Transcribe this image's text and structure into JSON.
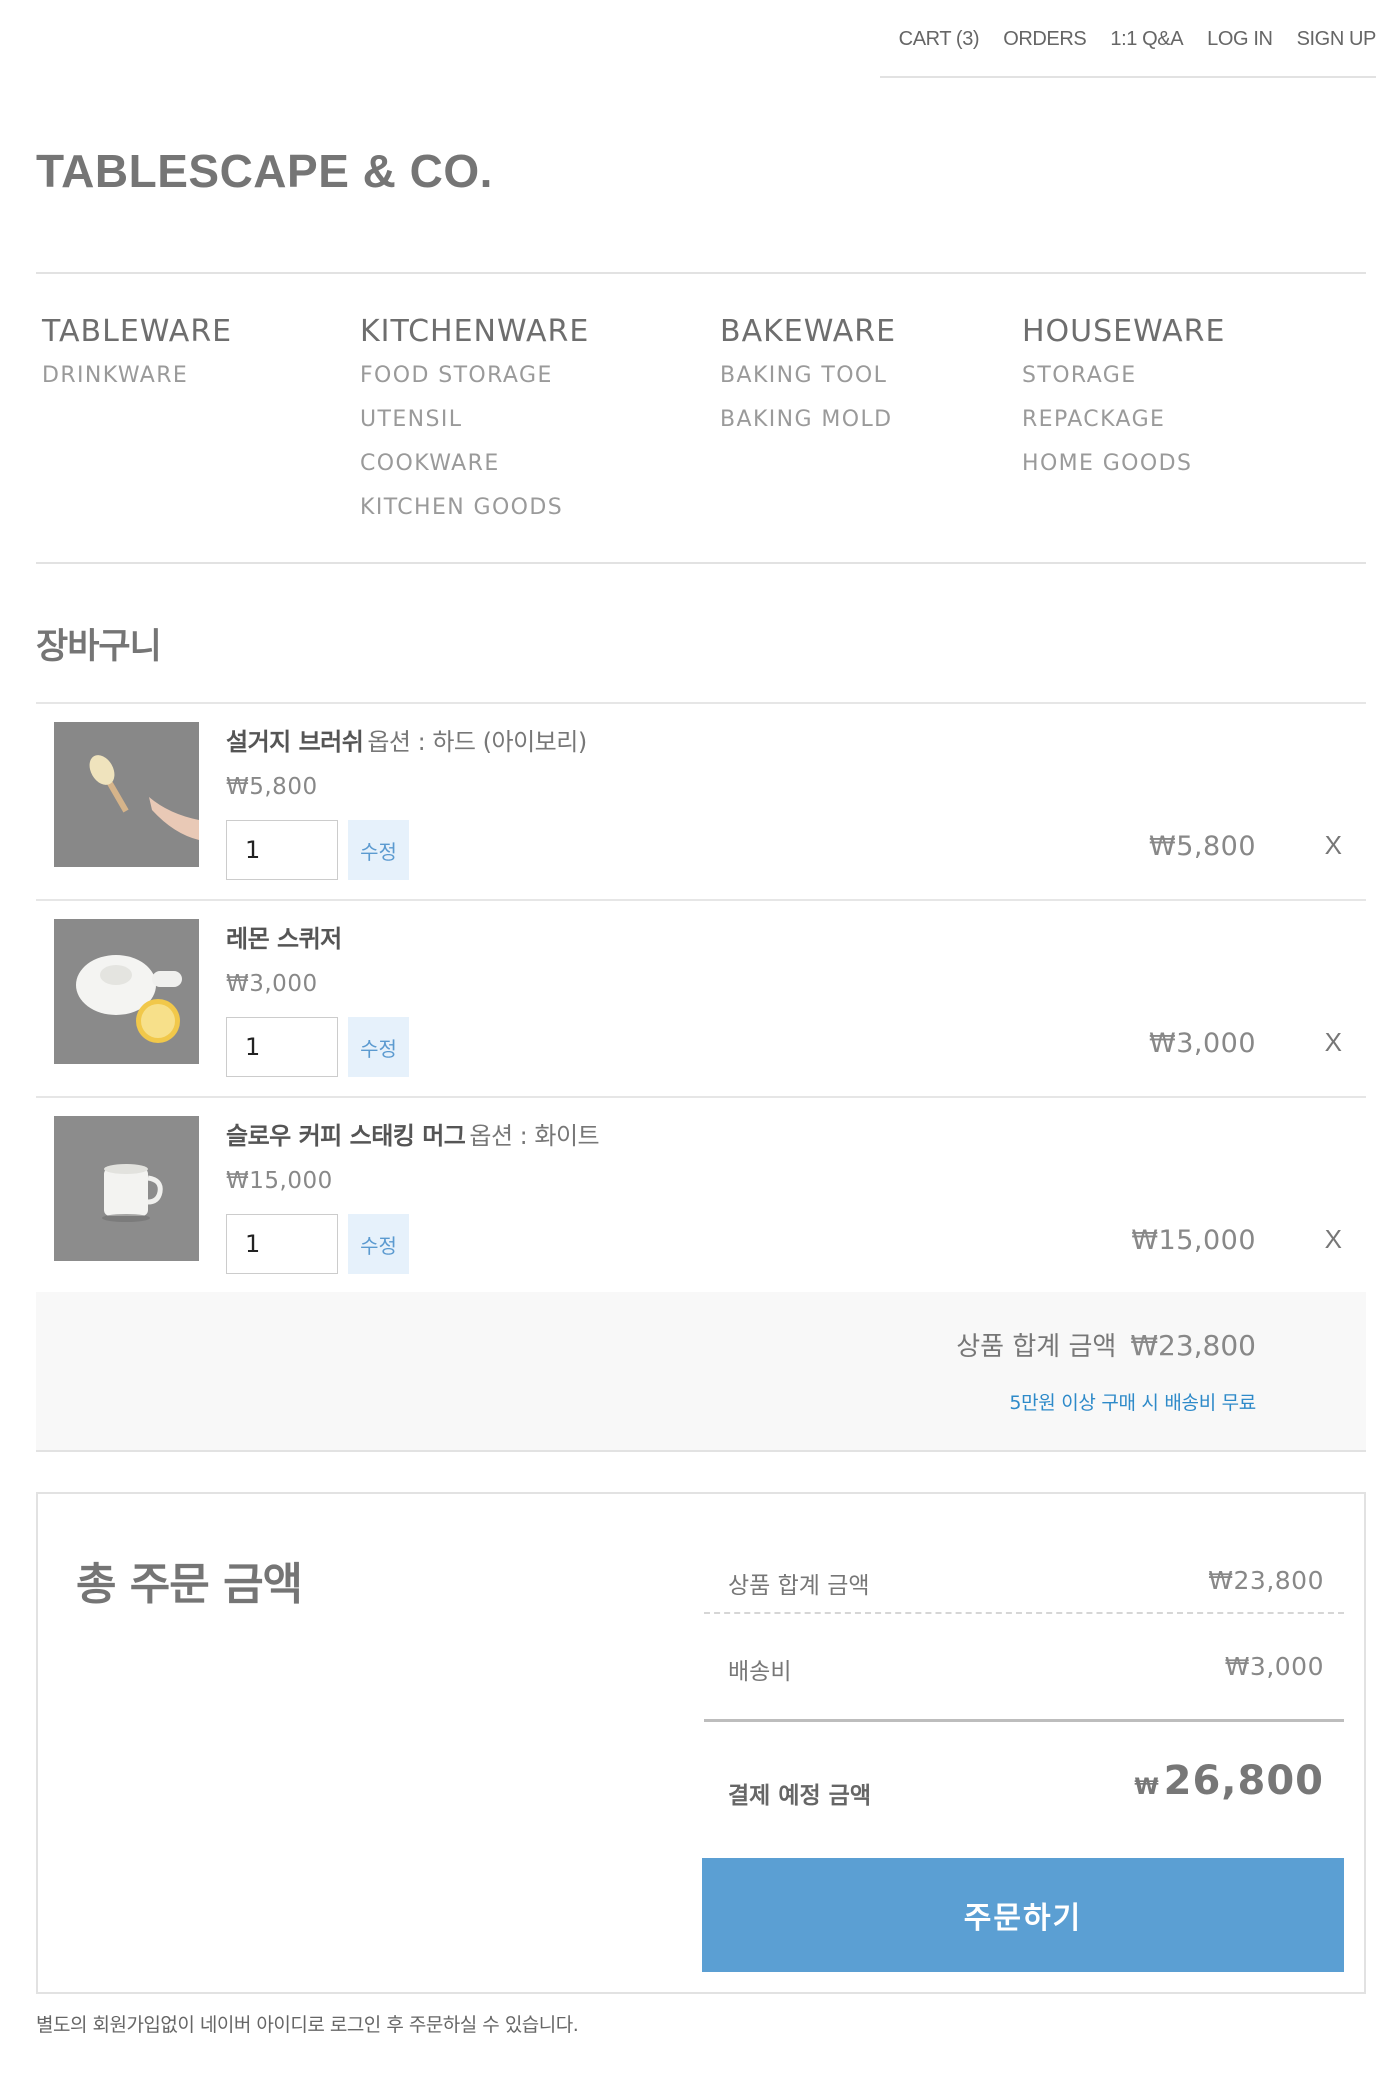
{
  "top_nav": {
    "cart": "CART (3)",
    "orders": "ORDERS",
    "qna": "1:1 Q&A",
    "login": "LOG IN",
    "signup": "SIGN UP"
  },
  "brand": {
    "logo": "TABLESCAPE & CO."
  },
  "categories": [
    {
      "title": "TABLEWARE",
      "items": [
        "DRINKWARE"
      ]
    },
    {
      "title": "KITCHENWARE",
      "items": [
        "FOOD STORAGE",
        "UTENSIL",
        "COOKWARE",
        "KITCHEN GOODS"
      ]
    },
    {
      "title": "BAKEWARE",
      "items": [
        "BAKING TOOL",
        "BAKING MOLD"
      ]
    },
    {
      "title": "HOUSEWARE",
      "items": [
        "STORAGE",
        "REPACKAGE",
        "HOME GOODS"
      ]
    }
  ],
  "cart": {
    "title": "장바구니",
    "items": [
      {
        "name": "설거지 브러쉬",
        "option": "옵션 : 하드 (아이보리)",
        "price": "₩5,800",
        "quantity": "1",
        "edit_label": "수정",
        "subtotal": "₩5,800",
        "remove_label": "X",
        "image": "brush-photo"
      },
      {
        "name": "레몬 스퀴저",
        "option": "",
        "price": "₩3,000",
        "quantity": "1",
        "edit_label": "수정",
        "subtotal": "₩3,000",
        "remove_label": "X",
        "image": "lemon-squeezer-photo"
      },
      {
        "name": "슬로우 커피 스태킹 머그",
        "option": "옵션 : 화이트",
        "price": "₩15,000",
        "quantity": "1",
        "edit_label": "수정",
        "subtotal": "₩15,000",
        "remove_label": "X",
        "image": "mug-photo"
      }
    ],
    "summary_label": "상품 합계 금액",
    "summary_amount": "₩23,800",
    "free_shipping_note": "5만원 이상 구매 시 배송비 무료"
  },
  "total": {
    "title": "총 주문 금액",
    "product_total_label": "상품 합계 금액",
    "product_total": "₩23,800",
    "shipping_label": "배송비",
    "shipping": "₩3,000",
    "payment_label": "결제 예정 금액",
    "payment_currency": "₩",
    "payment_amount": "26,800",
    "order_button": "주문하기"
  },
  "footnote": "별도의 회원가입없이 네이버 아이디로 로그인 후 주문하실 수 있습니다.",
  "colors": {
    "accent": "#5b9fd3",
    "link_blue": "#2e8ac9",
    "edit_bg": "#e6f1fb"
  }
}
